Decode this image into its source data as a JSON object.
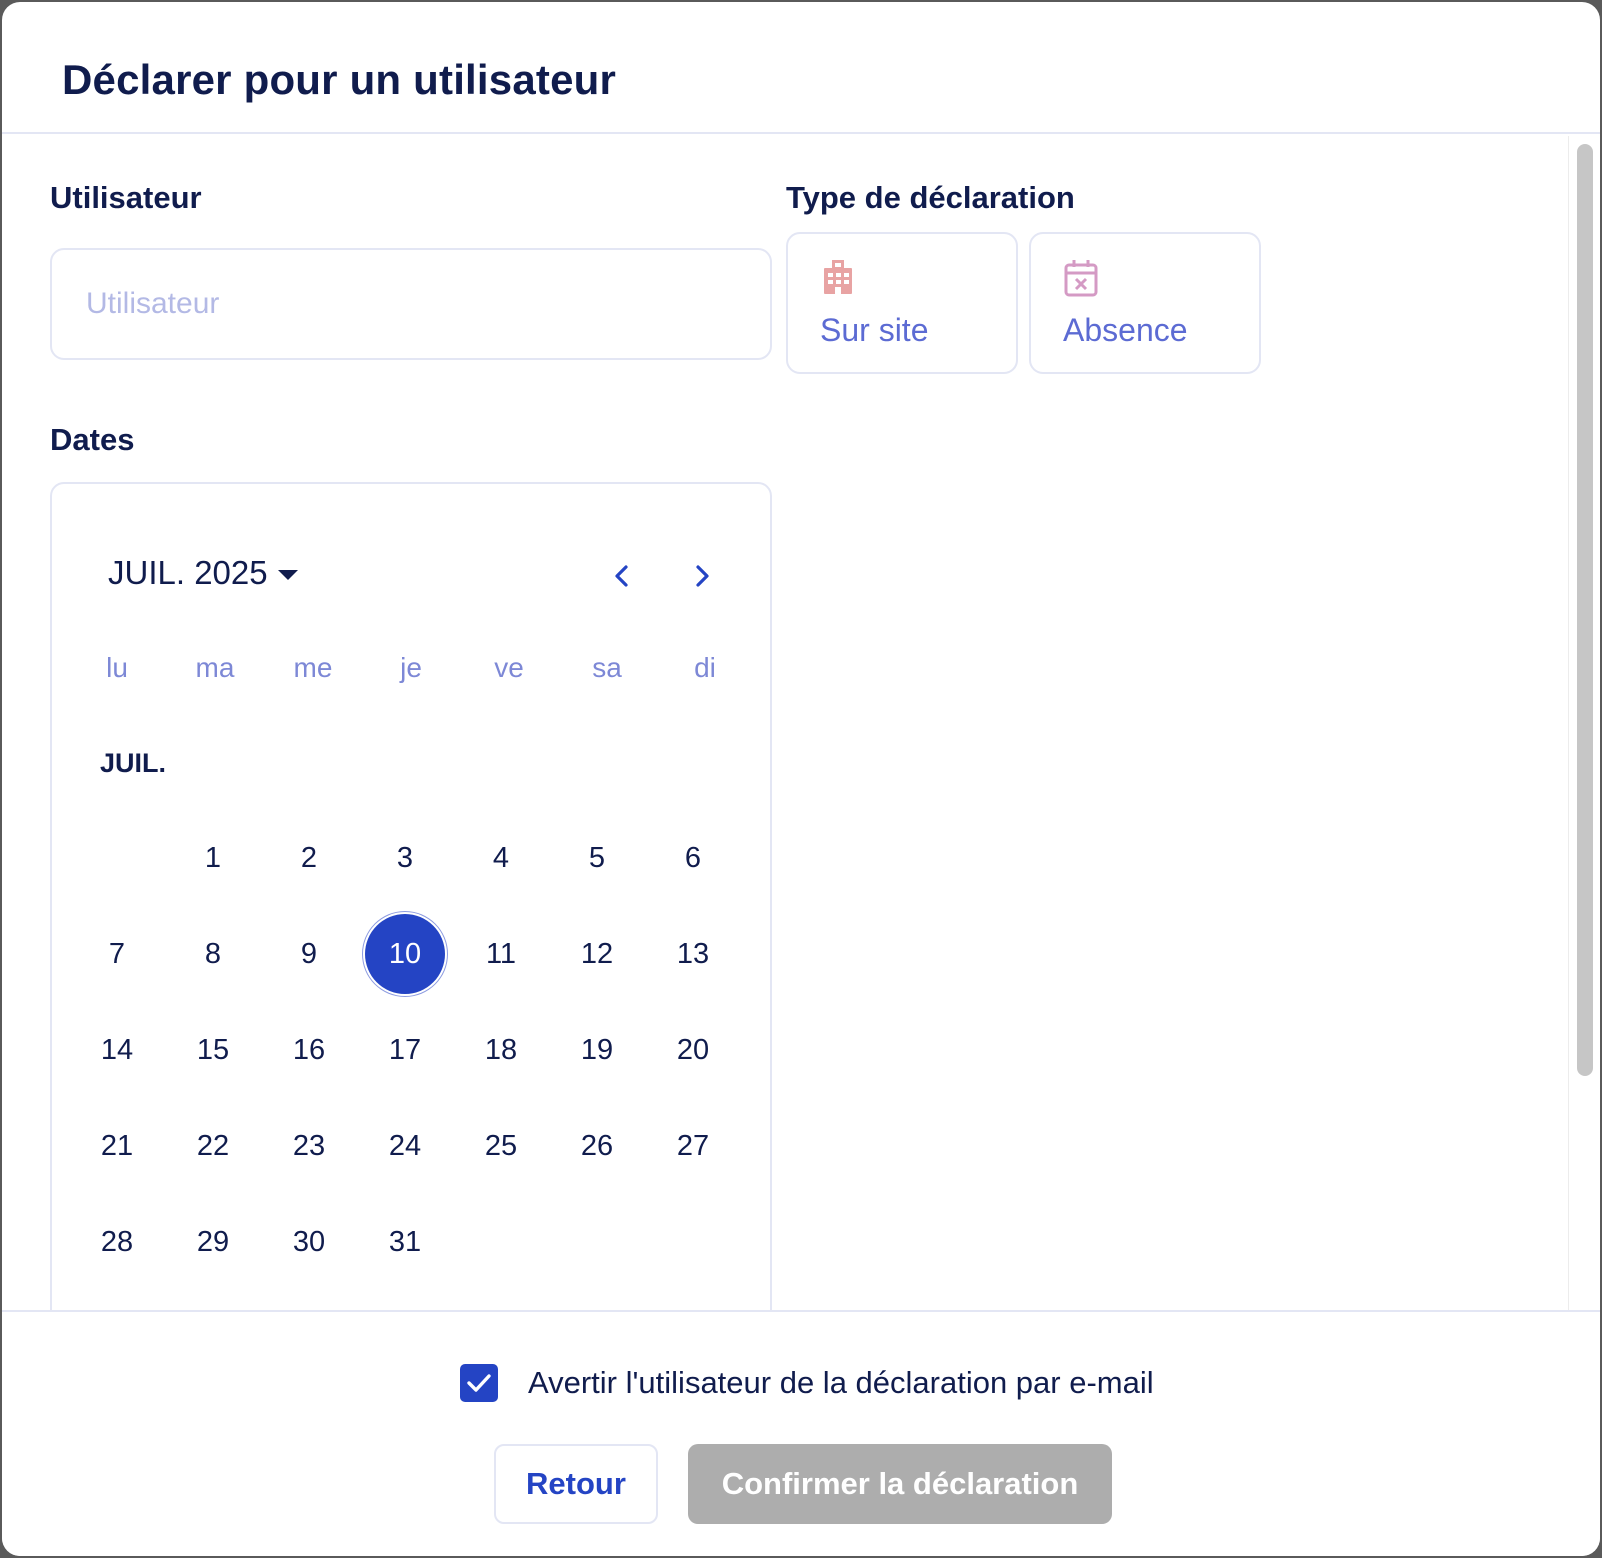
{
  "dialog": {
    "title": "Déclarer pour un utilisateur"
  },
  "user": {
    "label": "Utilisateur",
    "placeholder": "Utilisateur",
    "value": ""
  },
  "declaration_type": {
    "label": "Type de déclaration",
    "options": [
      {
        "label": "Sur site",
        "icon": "building-icon",
        "color": "#e8a3a3"
      },
      {
        "label": "Absence",
        "icon": "calendar-x-icon",
        "color": "#d49ac4"
      }
    ]
  },
  "dates": {
    "label": "Dates",
    "month_select": "JUIL. 2025",
    "weekdays": [
      "lu",
      "ma",
      "me",
      "je",
      "ve",
      "sa",
      "di"
    ],
    "month_label": "JUIL.",
    "weeks": [
      [
        "",
        "1",
        "2",
        "3",
        "4",
        "5",
        "6"
      ],
      [
        "7",
        "8",
        "9",
        "10",
        "11",
        "12",
        "13"
      ],
      [
        "14",
        "15",
        "16",
        "17",
        "18",
        "19",
        "20"
      ],
      [
        "21",
        "22",
        "23",
        "24",
        "25",
        "26",
        "27"
      ],
      [
        "28",
        "29",
        "30",
        "31",
        "",
        "",
        ""
      ]
    ],
    "selected_day": "10",
    "prev_icon": "chevron-left-icon",
    "next_icon": "chevron-right-icon"
  },
  "footer": {
    "notify_checked": true,
    "notify_label": "Avertir l'utilisateur de la déclaration par e-mail",
    "back_label": "Retour",
    "confirm_label": "Confirmer la déclaration"
  },
  "colors": {
    "primary": "#2444c4",
    "text": "#101c4d",
    "muted": "#7d88d6",
    "border": "#e3e6f4",
    "disabled": "#adadad"
  }
}
